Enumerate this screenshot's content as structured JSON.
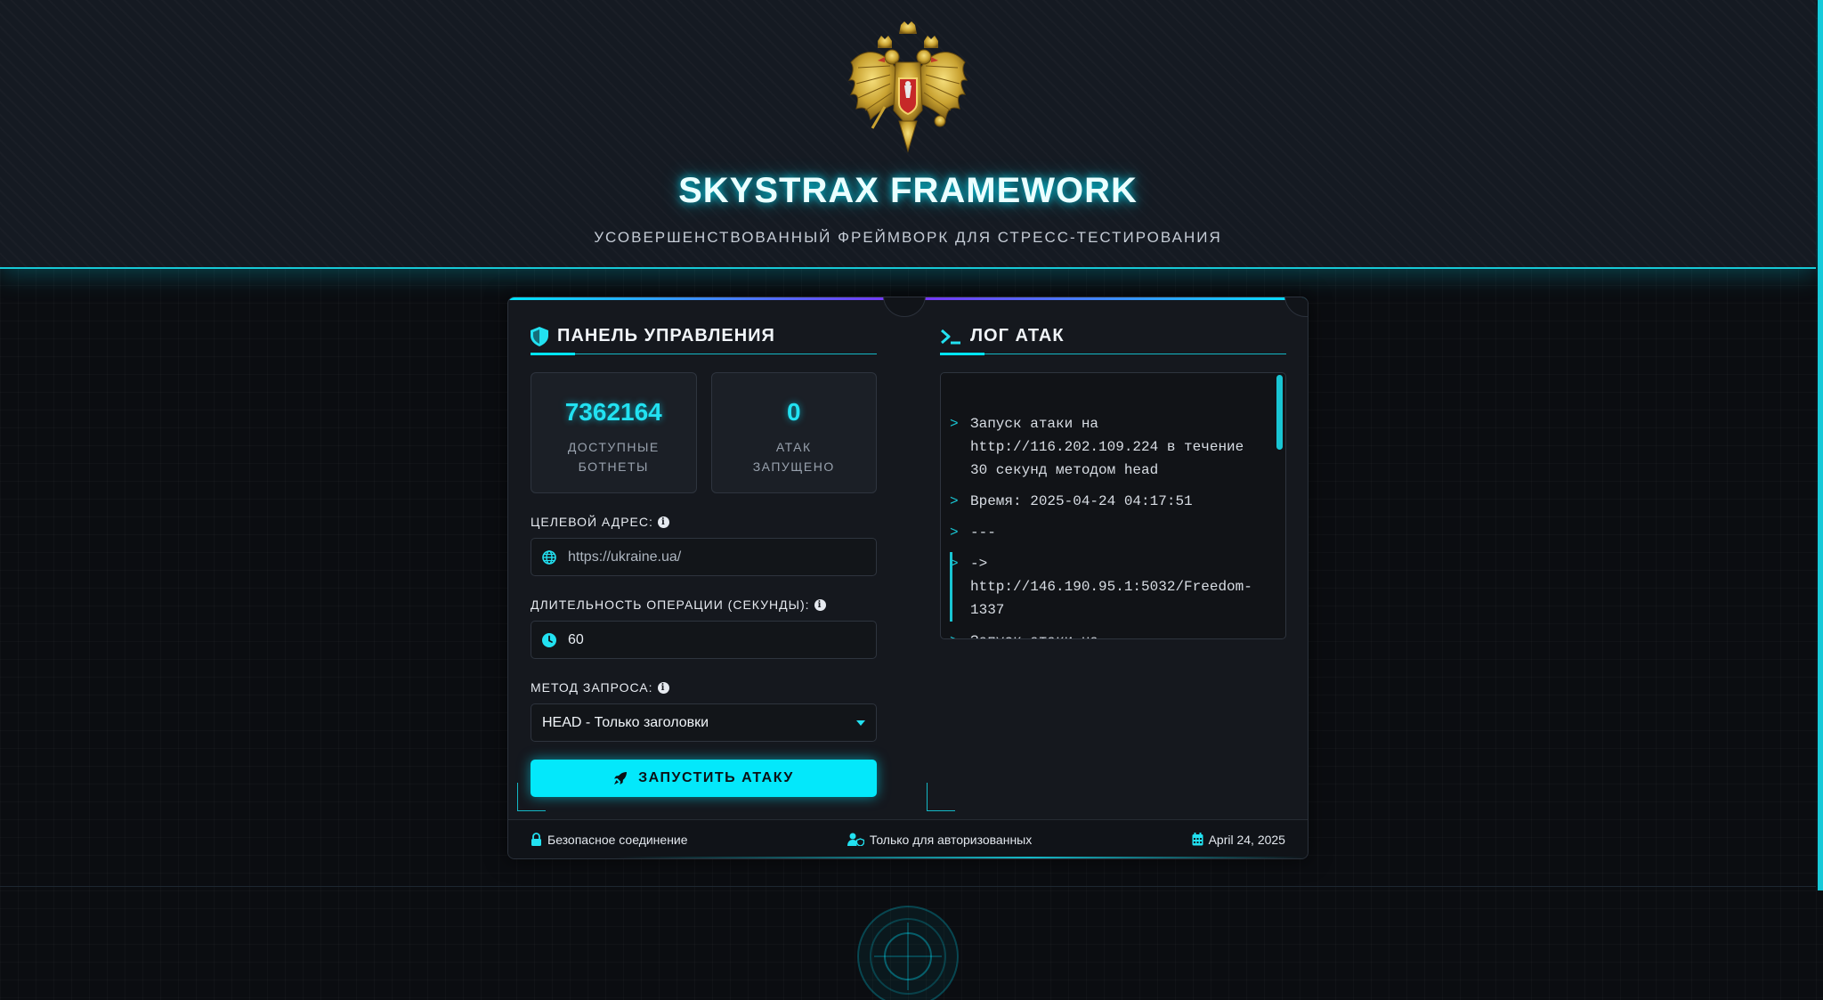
{
  "header": {
    "title": "SKYSTRAX FRAMEWORK",
    "subtitle": "УСОВЕРШЕНСТВОВАННЫЙ ФРЕЙМВОРК ДЛЯ СТРЕСС-ТЕСТИРОВАНИЯ",
    "emblem_icon": "double-headed-eagle-emblem"
  },
  "control_panel": {
    "title": "ПАНЕЛЬ УПРАВЛЕНИЯ",
    "icon": "shield-icon",
    "stats": [
      {
        "value": "7362164",
        "label": "ДОСТУПНЫЕ БОТНЕТЫ"
      },
      {
        "value": "0",
        "label": "АТАК ЗАПУЩЕНО"
      }
    ],
    "target": {
      "label": "ЦЕЛЕВОЙ АДРЕС:",
      "placeholder": "https://ukraine.ua/",
      "value": "",
      "icon": "globe-icon"
    },
    "duration": {
      "label": "ДЛИТЕЛЬНОСТЬ ОПЕРАЦИИ (СЕКУНДЫ):",
      "value": "60",
      "icon": "clock-icon"
    },
    "method": {
      "label": "МЕТОД ЗАПРОСА:",
      "selected": "HEAD - Только заголовки"
    },
    "launch_label": "ЗАПУСТИТЬ АТАКУ"
  },
  "log": {
    "title": "ЛОГ АТАК",
    "icon": "terminal-icon",
    "prompt": ">",
    "lines": [
      "Запуск атаки на http://116.202.109.224 в течение 30 секунд методом head",
      "Время: 2025-04-24 04:17:51",
      "---",
      "-> http://146.190.95.1:5032/Freedom-1337",
      "Запуск атаки на"
    ]
  },
  "footer": {
    "secure": "Безопасное соединение",
    "authorized": "Только для авторизованных",
    "date": "April 24, 2025"
  },
  "colors": {
    "accent": "#00e5ff",
    "accent_purple": "#7b2ff7",
    "background": "#0b0d11",
    "panel": "#15181e"
  }
}
